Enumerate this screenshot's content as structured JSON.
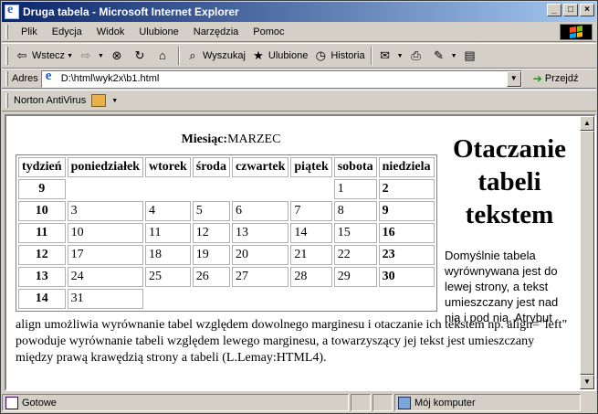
{
  "window": {
    "title": "Druga tabela - Microsoft Internet Explorer",
    "controls": {
      "minimize": "_",
      "maximize": "□",
      "close": "×"
    }
  },
  "menu": [
    "Plik",
    "Edycja",
    "Widok",
    "Ulubione",
    "Narzędzia",
    "Pomoc"
  ],
  "toolbar": {
    "back": "Wstecz",
    "search": "Wyszukaj",
    "favorites": "Ulubione",
    "history": "Historia",
    "icons": [
      "back-arrow-icon",
      "forward-arrow-icon",
      "stop-icon",
      "refresh-icon",
      "home-icon",
      "search-icon",
      "favorites-icon",
      "history-icon",
      "mail-icon",
      "print-icon",
      "edit-icon",
      "discuss-icon"
    ]
  },
  "address": {
    "label": "Adres",
    "value": "D:\\html\\wyk2x\\b1.html",
    "go": "Przejdź"
  },
  "links": {
    "norton": "Norton AntiVirus"
  },
  "page": {
    "caption_label": "Miesiąc:",
    "caption_value": "MARZEC",
    "headers": [
      "tydzień",
      "poniedziałek",
      "wtorek",
      "środa",
      "czwartek",
      "piątek",
      "sobota",
      "niedziela"
    ],
    "rows": [
      [
        "9",
        "",
        "",
        "",
        "",
        "",
        "1",
        "2"
      ],
      [
        "10",
        "3",
        "4",
        "5",
        "6",
        "7",
        "8",
        "9"
      ],
      [
        "11",
        "10",
        "11",
        "12",
        "13",
        "14",
        "15",
        "16"
      ],
      [
        "12",
        "17",
        "18",
        "19",
        "20",
        "21",
        "22",
        "23"
      ],
      [
        "13",
        "24",
        "25",
        "26",
        "27",
        "28",
        "29",
        "30"
      ],
      [
        "14",
        "31"
      ]
    ],
    "side_heading": "Otaczanie tabeli tekstem",
    "side_text": "Domyślnie tabela wyrównywana jest do lewej strony, a tekst umieszczany jest nad nią i pod nią. Atrybut",
    "bottom_text": "align umożliwia wyrównanie tabel względem dowolnego marginesu i otaczanie ich tekstem np. align=\"left\" powoduje wyrównanie tabeli względem lewego marginesu, a towarzyszący jej tekst jest umieszczany między prawą krawędzią strony a tabeli (L.Lemay:HTML4)."
  },
  "status": {
    "text": "Gotowe",
    "zone": "Mój komputer"
  }
}
